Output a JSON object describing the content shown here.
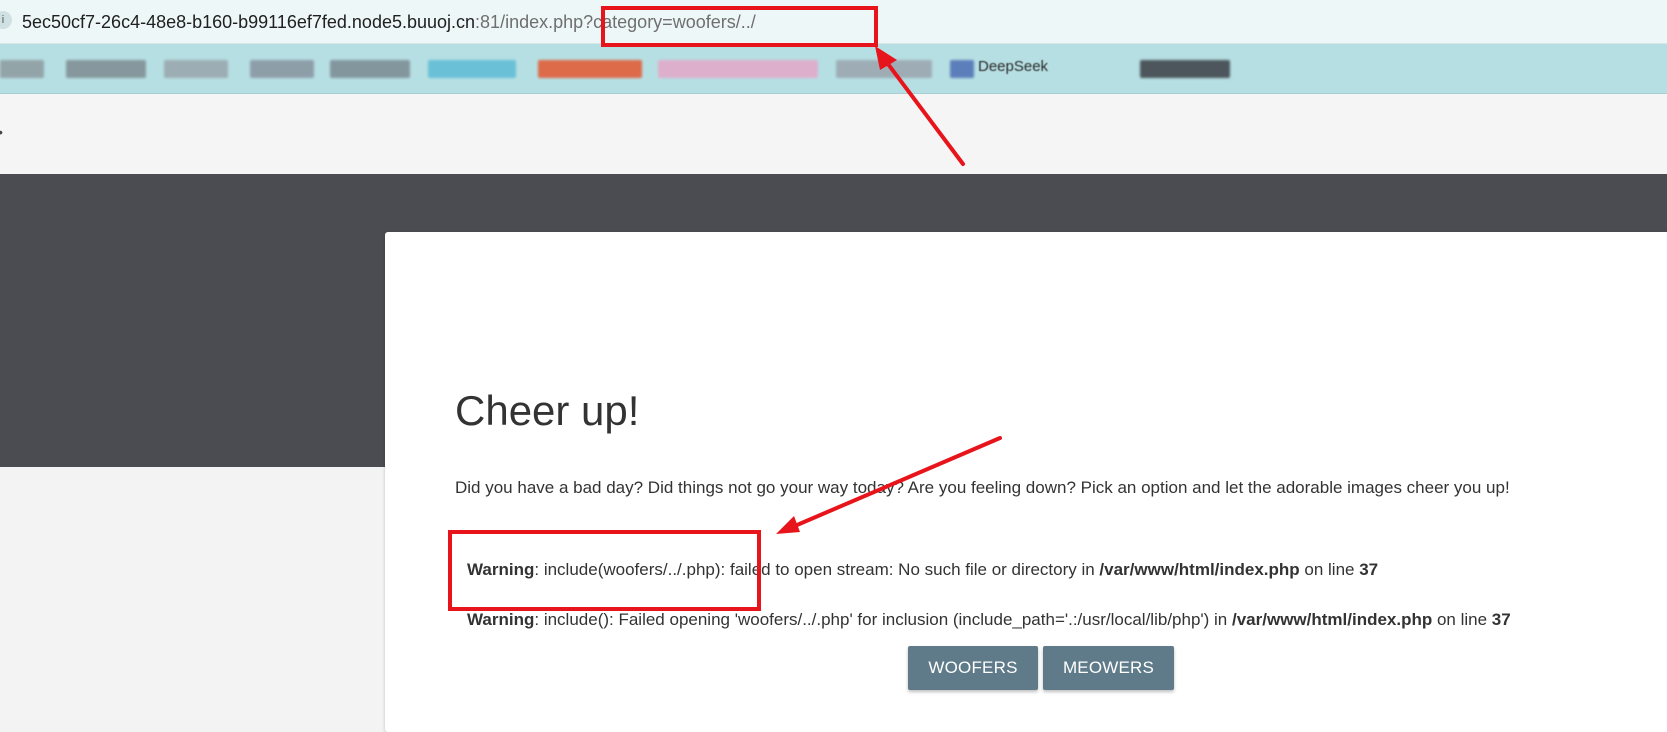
{
  "browser": {
    "url_host": "5ec50cf7-26c4-48e8-b160-b99116ef7fed.node5.buuoj.cn",
    "url_rest": ":81/index.php?category=woofers/../",
    "site_icon": "site-info-icon"
  },
  "bookmarks": {
    "visible_label": "DeepSeek",
    "items": [
      {
        "color": "#8d9aa0"
      },
      {
        "color": "#7e8c92"
      },
      {
        "color": "#98a5ab"
      },
      {
        "color": "#8893a0"
      },
      {
        "color": "#7b8a93"
      },
      {
        "color": "#5cbbd6"
      },
      {
        "color": "#e4562f"
      },
      {
        "color": "#e6a7c9"
      },
      {
        "color": "#9aa4ad"
      },
      {
        "color": "#4d6fb5"
      },
      {
        "color": "#3a3f45"
      },
      {
        "color": "#8a949c"
      }
    ]
  },
  "page": {
    "title": "Cheer up!",
    "intro": "Did you have a bad day? Did things not go your way today? Are you feeling down? Pick an option and let the adorable images cheer you up!",
    "warning1": {
      "label": "Warning",
      "text_before": ": include(woofers/../.php): failed to open stream: No such file or directory in ",
      "file": "/var/www/html/index.php",
      "text_mid": " on line ",
      "line": "37"
    },
    "warning2": {
      "label": "Warning",
      "text_before": ": include(): Failed opening 'woofers/../.php' for inclusion (include_path='.:/usr/local/lib/php') in ",
      "file": "/var/www/html/index.php",
      "text_mid": " on line ",
      "line": "37"
    },
    "buttons": {
      "woofers": "WOOFERS",
      "meowers": "MEOWERS"
    }
  },
  "colors": {
    "annotation_red": "#e8141b",
    "hero_dark": "#4b4c52",
    "button_bg": "#5f7b89"
  }
}
